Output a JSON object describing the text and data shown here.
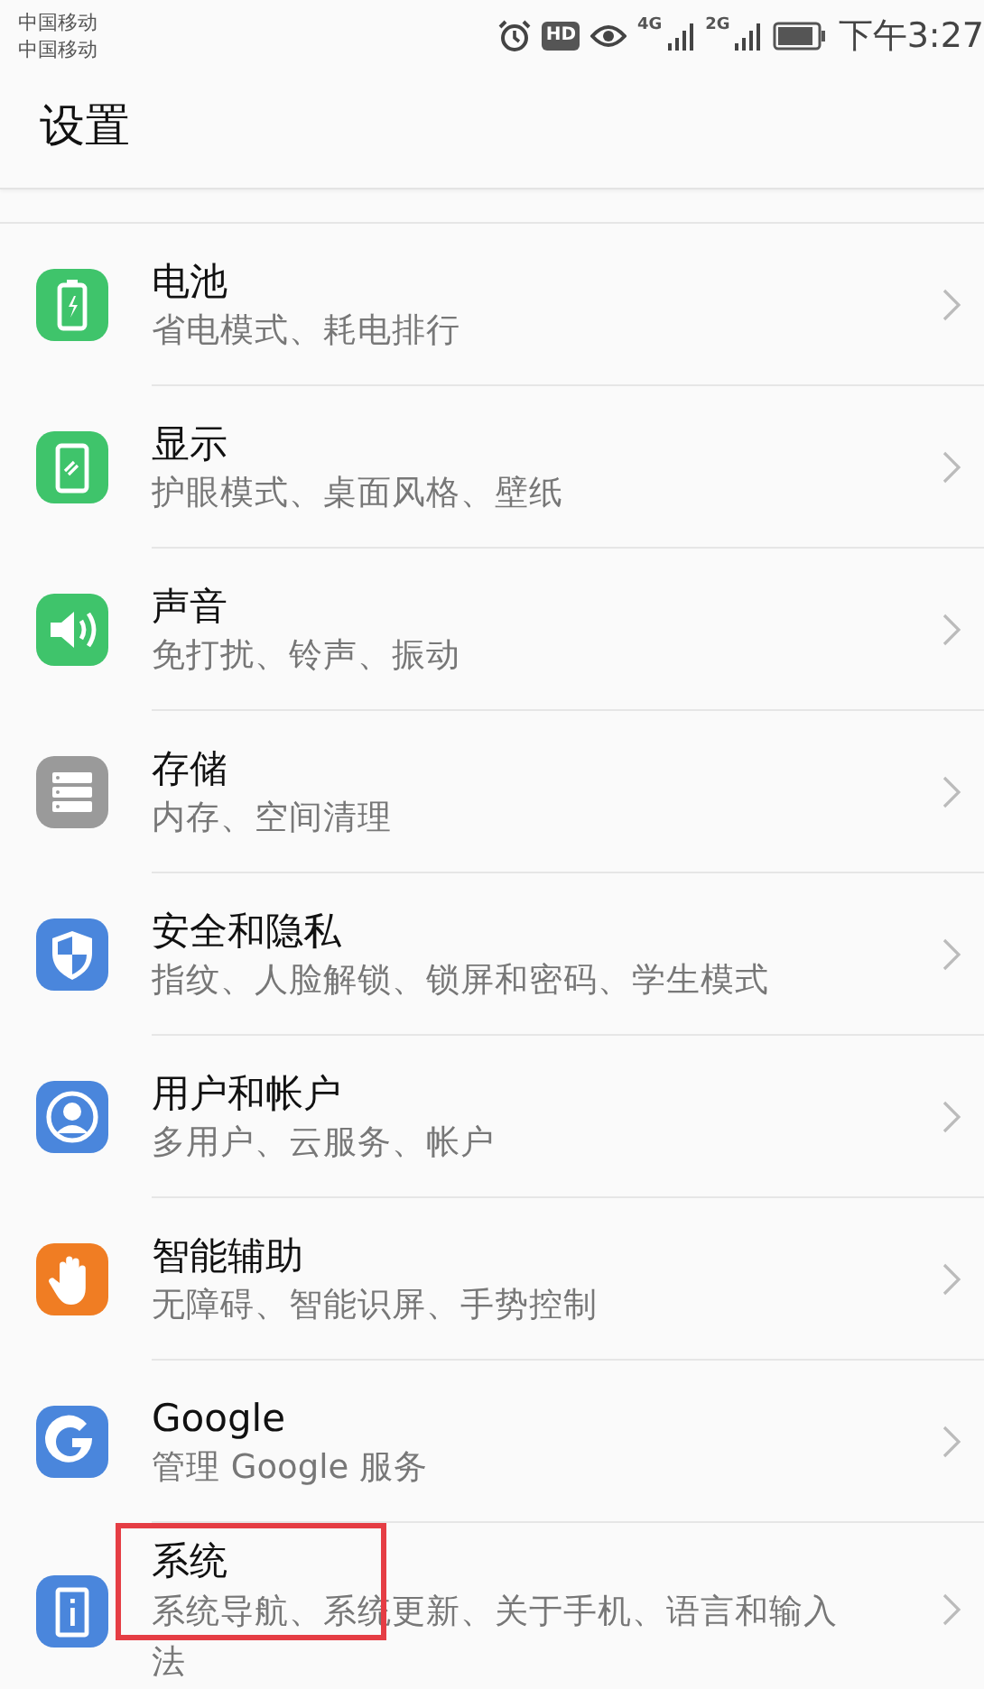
{
  "status_bar": {
    "carriers": [
      "中国移动",
      "中国移动"
    ],
    "hd": "HD",
    "networks": [
      "4G",
      "2G"
    ],
    "time": "下午3:27"
  },
  "title": "设置",
  "items": [
    {
      "title": "电池",
      "subtitle": "省电模式、耗电排行",
      "kind": "battery",
      "color": "#3fc46b",
      "highlighted": false
    },
    {
      "title": "显示",
      "subtitle": "护眼模式、桌面风格、壁纸",
      "kind": "display",
      "color": "#3fc46b",
      "highlighted": false
    },
    {
      "title": "声音",
      "subtitle": "免打扰、铃声、振动",
      "kind": "sound",
      "color": "#3fc46b",
      "highlighted": false
    },
    {
      "title": "存储",
      "subtitle": "内存、空间清理",
      "kind": "storage",
      "color": "#9a9a9a",
      "highlighted": false
    },
    {
      "title": "安全和隐私",
      "subtitle": "指纹、人脸解锁、锁屏和密码、学生模式",
      "kind": "shield",
      "color": "#4a86dc",
      "highlighted": false
    },
    {
      "title": "用户和帐户",
      "subtitle": "多用户、云服务、帐户",
      "kind": "user",
      "color": "#4a86dc",
      "highlighted": false
    },
    {
      "title": "智能辅助",
      "subtitle": "无障碍、智能识屏、手势控制",
      "kind": "hand",
      "color": "#f07d23",
      "highlighted": false
    },
    {
      "title": "Google",
      "subtitle": "管理 Google 服务",
      "kind": "google",
      "color": "#4a86dc",
      "highlighted": false
    },
    {
      "title": "系统",
      "subtitle": "系统导航、系统更新、关于手机、语言和输入法",
      "kind": "info",
      "color": "#4a86dc",
      "highlighted": true
    }
  ]
}
